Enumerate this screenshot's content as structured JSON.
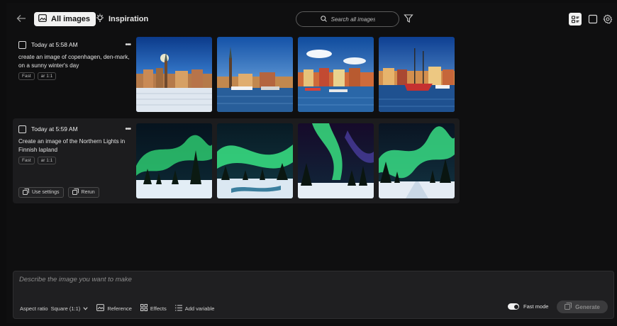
{
  "header": {
    "tab_all_label": "All images",
    "tab_inspiration_label": "Inspiration",
    "search_placeholder": "Search all images"
  },
  "generations": [
    {
      "timestamp": "Today at 5:58 AM",
      "prompt": "create an image of copenhagen, den-mark, on a sunny winter's day",
      "tags": [
        "Fast",
        "ar 1:1"
      ]
    },
    {
      "timestamp": "Today at 5:59 AM",
      "prompt": "Create an image of the Northern Lights in Finnish lapland",
      "tags": [
        "Fast",
        "ar 1:1"
      ],
      "actions": [
        "Use settings",
        "Rerun"
      ]
    }
  ],
  "composer": {
    "placeholder": "Describe the image you want to make",
    "aspect_ratio_label": "Aspect ratio",
    "aspect_ratio_value": "Square (1:1)",
    "reference_label": "Reference",
    "effects_label": "Effects",
    "add_variable_label": "Add variable",
    "fast_mode_label": "Fast mode",
    "generate_label": "Generate"
  },
  "colors": {
    "background": "#0f0f10",
    "selected_row": "#1c1c1e",
    "composer": "#1f1f21",
    "active_tab": "#f1f1f1"
  }
}
